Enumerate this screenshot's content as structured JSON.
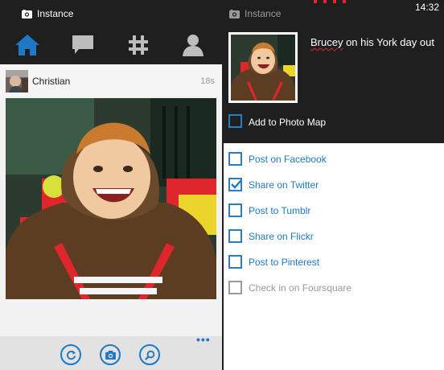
{
  "left": {
    "app_title": "Instance",
    "nav": [
      "home-icon",
      "chat-icon",
      "hashtag-icon",
      "person-icon"
    ],
    "post": {
      "user": "Christian",
      "time": "18s"
    },
    "appbar": {
      "buttons": [
        "refresh-icon",
        "camera-icon",
        "search-icon"
      ],
      "more": "•••"
    }
  },
  "right": {
    "app_title": "Instance",
    "clock": "14:32",
    "caption_first": "Brucey",
    "caption_rest": " on his York day out",
    "photo_map": {
      "label": "Add to Photo Map",
      "checked": false
    },
    "share": [
      {
        "label": "Post on Facebook",
        "checked": false,
        "enabled": true
      },
      {
        "label": "Share on Twitter",
        "checked": true,
        "enabled": true
      },
      {
        "label": "Post to Tumblr",
        "checked": false,
        "enabled": true
      },
      {
        "label": "Share on Flickr",
        "checked": false,
        "enabled": true
      },
      {
        "label": "Post to Pinterest",
        "checked": false,
        "enabled": true
      },
      {
        "label": "Check in on Foursquare",
        "checked": false,
        "enabled": false
      }
    ]
  },
  "colors": {
    "accent": "#1d79c6",
    "dark": "#1f1f1f",
    "disabled": "#9a9a9a"
  }
}
